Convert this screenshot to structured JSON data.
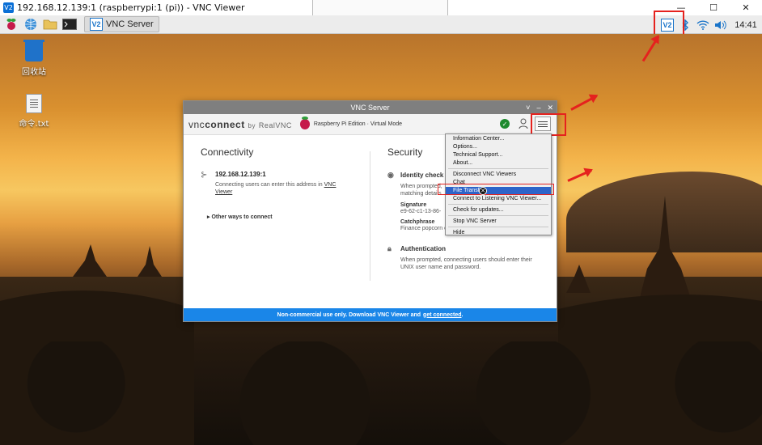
{
  "viewer": {
    "title": "192.168.12.139:1 (raspberrypi:1 (pi)) - VNC Viewer",
    "icon": "vnc-viewer-icon",
    "minimize": "—",
    "maximize": "☐",
    "close": "✕"
  },
  "taskbar": {
    "launchers": [
      "raspberry-menu-icon",
      "browser-globe-icon",
      "file-manager-icon",
      "terminal-icon"
    ],
    "task_label": "VNC Server",
    "clock": "14:41"
  },
  "desktop": {
    "icons": [
      {
        "label": "回收站",
        "icon": "trash-icon"
      },
      {
        "label": "命令.txt",
        "icon": "text-file-icon"
      }
    ]
  },
  "vnc_server": {
    "title": "VNC Server",
    "brand_vnc": "vnc",
    "brand_connect": "connect",
    "brand_by": "by",
    "brand_realvnc": "RealVNC",
    "edition": "Raspberry Pi Edition · Virtual Mode",
    "connectivity": {
      "heading": "Connectivity",
      "address": "192.168.12.139:1",
      "desc": "Connecting users can enter this address in",
      "desc_link": "VNC Viewer",
      "other_ways": "Other ways to connect"
    },
    "security": {
      "heading": "Security",
      "identity_title": "Identity check",
      "identity_text": "When prompted, matching details",
      "signature_label": "Signature",
      "signature_value": "e9-62-c1-13-86-",
      "catchphrase_label": "Catchphrase",
      "catchphrase_value": "Finance popcorn chamber. Genesis Jimmy trapeze",
      "auth_title": "Authentication",
      "auth_text": "When prompted, connecting users should enter their UNIX user name and password."
    },
    "footer_text": "Non-commercial use only. Download VNC Viewer and",
    "footer_link": "get connected",
    "footer_end": "."
  },
  "menu": {
    "items": [
      "Information Center...",
      "Options...",
      "Technical Support...",
      "About...",
      "Disconnect VNC Viewers",
      "Chat",
      "File Transfer",
      "Connect to Listening VNC Viewer...",
      "Check for updates...",
      "Stop VNC Server",
      "Hide"
    ],
    "active_item": "File Transfer"
  },
  "colors": {
    "annotation_red": "#e5221e",
    "vnc_blue": "#1a86e8",
    "menu_highlight": "#2e64c9"
  }
}
